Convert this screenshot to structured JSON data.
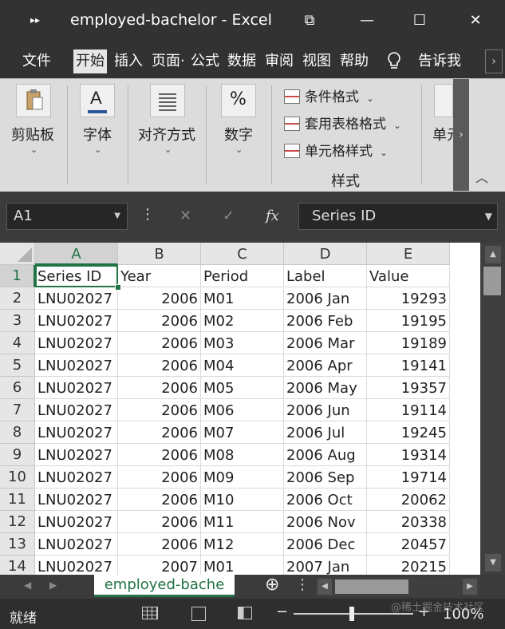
{
  "window": {
    "title": "employed-bachelor  -  Excel",
    "restore_glyph": "⧉",
    "minimize_glyph": "—",
    "maximize_glyph": "☐",
    "close_glyph": "✕"
  },
  "tabs": [
    {
      "label": "文件",
      "active": false
    },
    {
      "label": "开始",
      "active": true
    },
    {
      "label": "插入",
      "active": false
    },
    {
      "label": "页面·",
      "active": false
    },
    {
      "label": "公式",
      "active": false
    },
    {
      "label": "数据",
      "active": false
    },
    {
      "label": "审阅",
      "active": false
    },
    {
      "label": "视图",
      "active": false
    },
    {
      "label": "帮助",
      "active": false
    }
  ],
  "tell_me": "告诉我",
  "ribbon": {
    "clipboard": "剪贴板",
    "font": "字体",
    "font_glyph": "A",
    "alignment": "对齐方式",
    "number": "数字",
    "number_glyph": "%",
    "conditional_format": "条件格式",
    "format_as_table": "套用表格格式",
    "cell_styles": "单元格样式",
    "styles_group": "样式",
    "cells": "单元",
    "caret": "⌄"
  },
  "formula_bar": {
    "name_box": "A1",
    "cancel_glyph": "✕",
    "enter_glyph": "✓",
    "fx_glyph": "fx",
    "content": "Series ID"
  },
  "columns": [
    "A",
    "B",
    "C",
    "D",
    "E"
  ],
  "rows": [
    {
      "n": "1",
      "a": "Series ID",
      "b": "Year",
      "c": "Period",
      "d": "Label",
      "e": "Value"
    },
    {
      "n": "2",
      "a": "LNU02027",
      "b": "2006",
      "c": "M01",
      "d": "2006 Jan",
      "e": "19293"
    },
    {
      "n": "3",
      "a": "LNU02027",
      "b": "2006",
      "c": "M02",
      "d": "2006 Feb",
      "e": "19195"
    },
    {
      "n": "4",
      "a": "LNU02027",
      "b": "2006",
      "c": "M03",
      "d": "2006 Mar",
      "e": "19189"
    },
    {
      "n": "5",
      "a": "LNU02027",
      "b": "2006",
      "c": "M04",
      "d": "2006 Apr",
      "e": "19141"
    },
    {
      "n": "6",
      "a": "LNU02027",
      "b": "2006",
      "c": "M05",
      "d": "2006 May",
      "e": "19357"
    },
    {
      "n": "7",
      "a": "LNU02027",
      "b": "2006",
      "c": "M06",
      "d": "2006 Jun",
      "e": "19114"
    },
    {
      "n": "8",
      "a": "LNU02027",
      "b": "2006",
      "c": "M07",
      "d": "2006 Jul",
      "e": "19245"
    },
    {
      "n": "9",
      "a": "LNU02027",
      "b": "2006",
      "c": "M08",
      "d": "2006 Aug",
      "e": "19314"
    },
    {
      "n": "10",
      "a": "LNU02027",
      "b": "2006",
      "c": "M09",
      "d": "2006 Sep",
      "e": "19714"
    },
    {
      "n": "11",
      "a": "LNU02027",
      "b": "2006",
      "c": "M10",
      "d": "2006 Oct",
      "e": "20062"
    },
    {
      "n": "12",
      "a": "LNU02027",
      "b": "2006",
      "c": "M11",
      "d": "2006 Nov",
      "e": "20338"
    },
    {
      "n": "13",
      "a": "LNU02027",
      "b": "2006",
      "c": "M12",
      "d": "2006 Dec",
      "e": "20457"
    },
    {
      "n": "14",
      "a": "LNU02027",
      "b": "2007",
      "c": "M01",
      "d": "2007 Jan",
      "e": "20215"
    }
  ],
  "sheet_tab": "employed-bache",
  "add_sheet_glyph": "⊕",
  "status": {
    "ready": "就绪",
    "zoom": "100%",
    "watermark": "@稀土掘金技术社区",
    "minus": "−",
    "plus": "+"
  },
  "colors": {
    "accent_green": "#217346",
    "selection_green": "#1e7145"
  }
}
